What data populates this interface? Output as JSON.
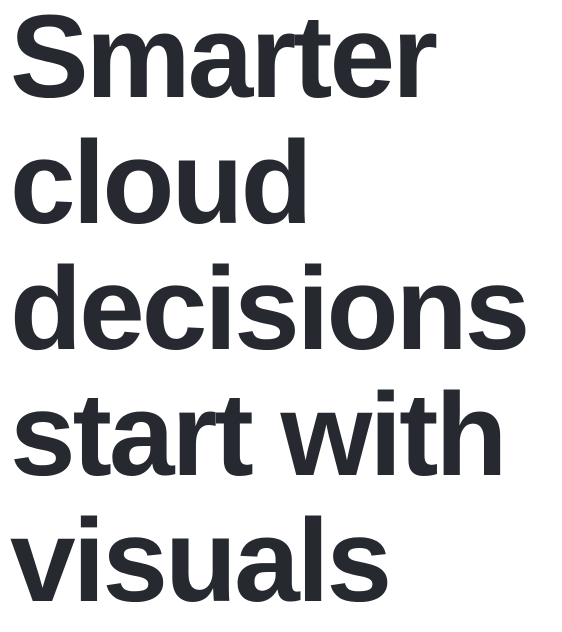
{
  "hero": {
    "headline_lines": [
      "Smarter",
      "cloud",
      "decisions",
      "start with",
      "visuals"
    ],
    "text_color": "#262a30",
    "background_color": "#ffffff"
  }
}
